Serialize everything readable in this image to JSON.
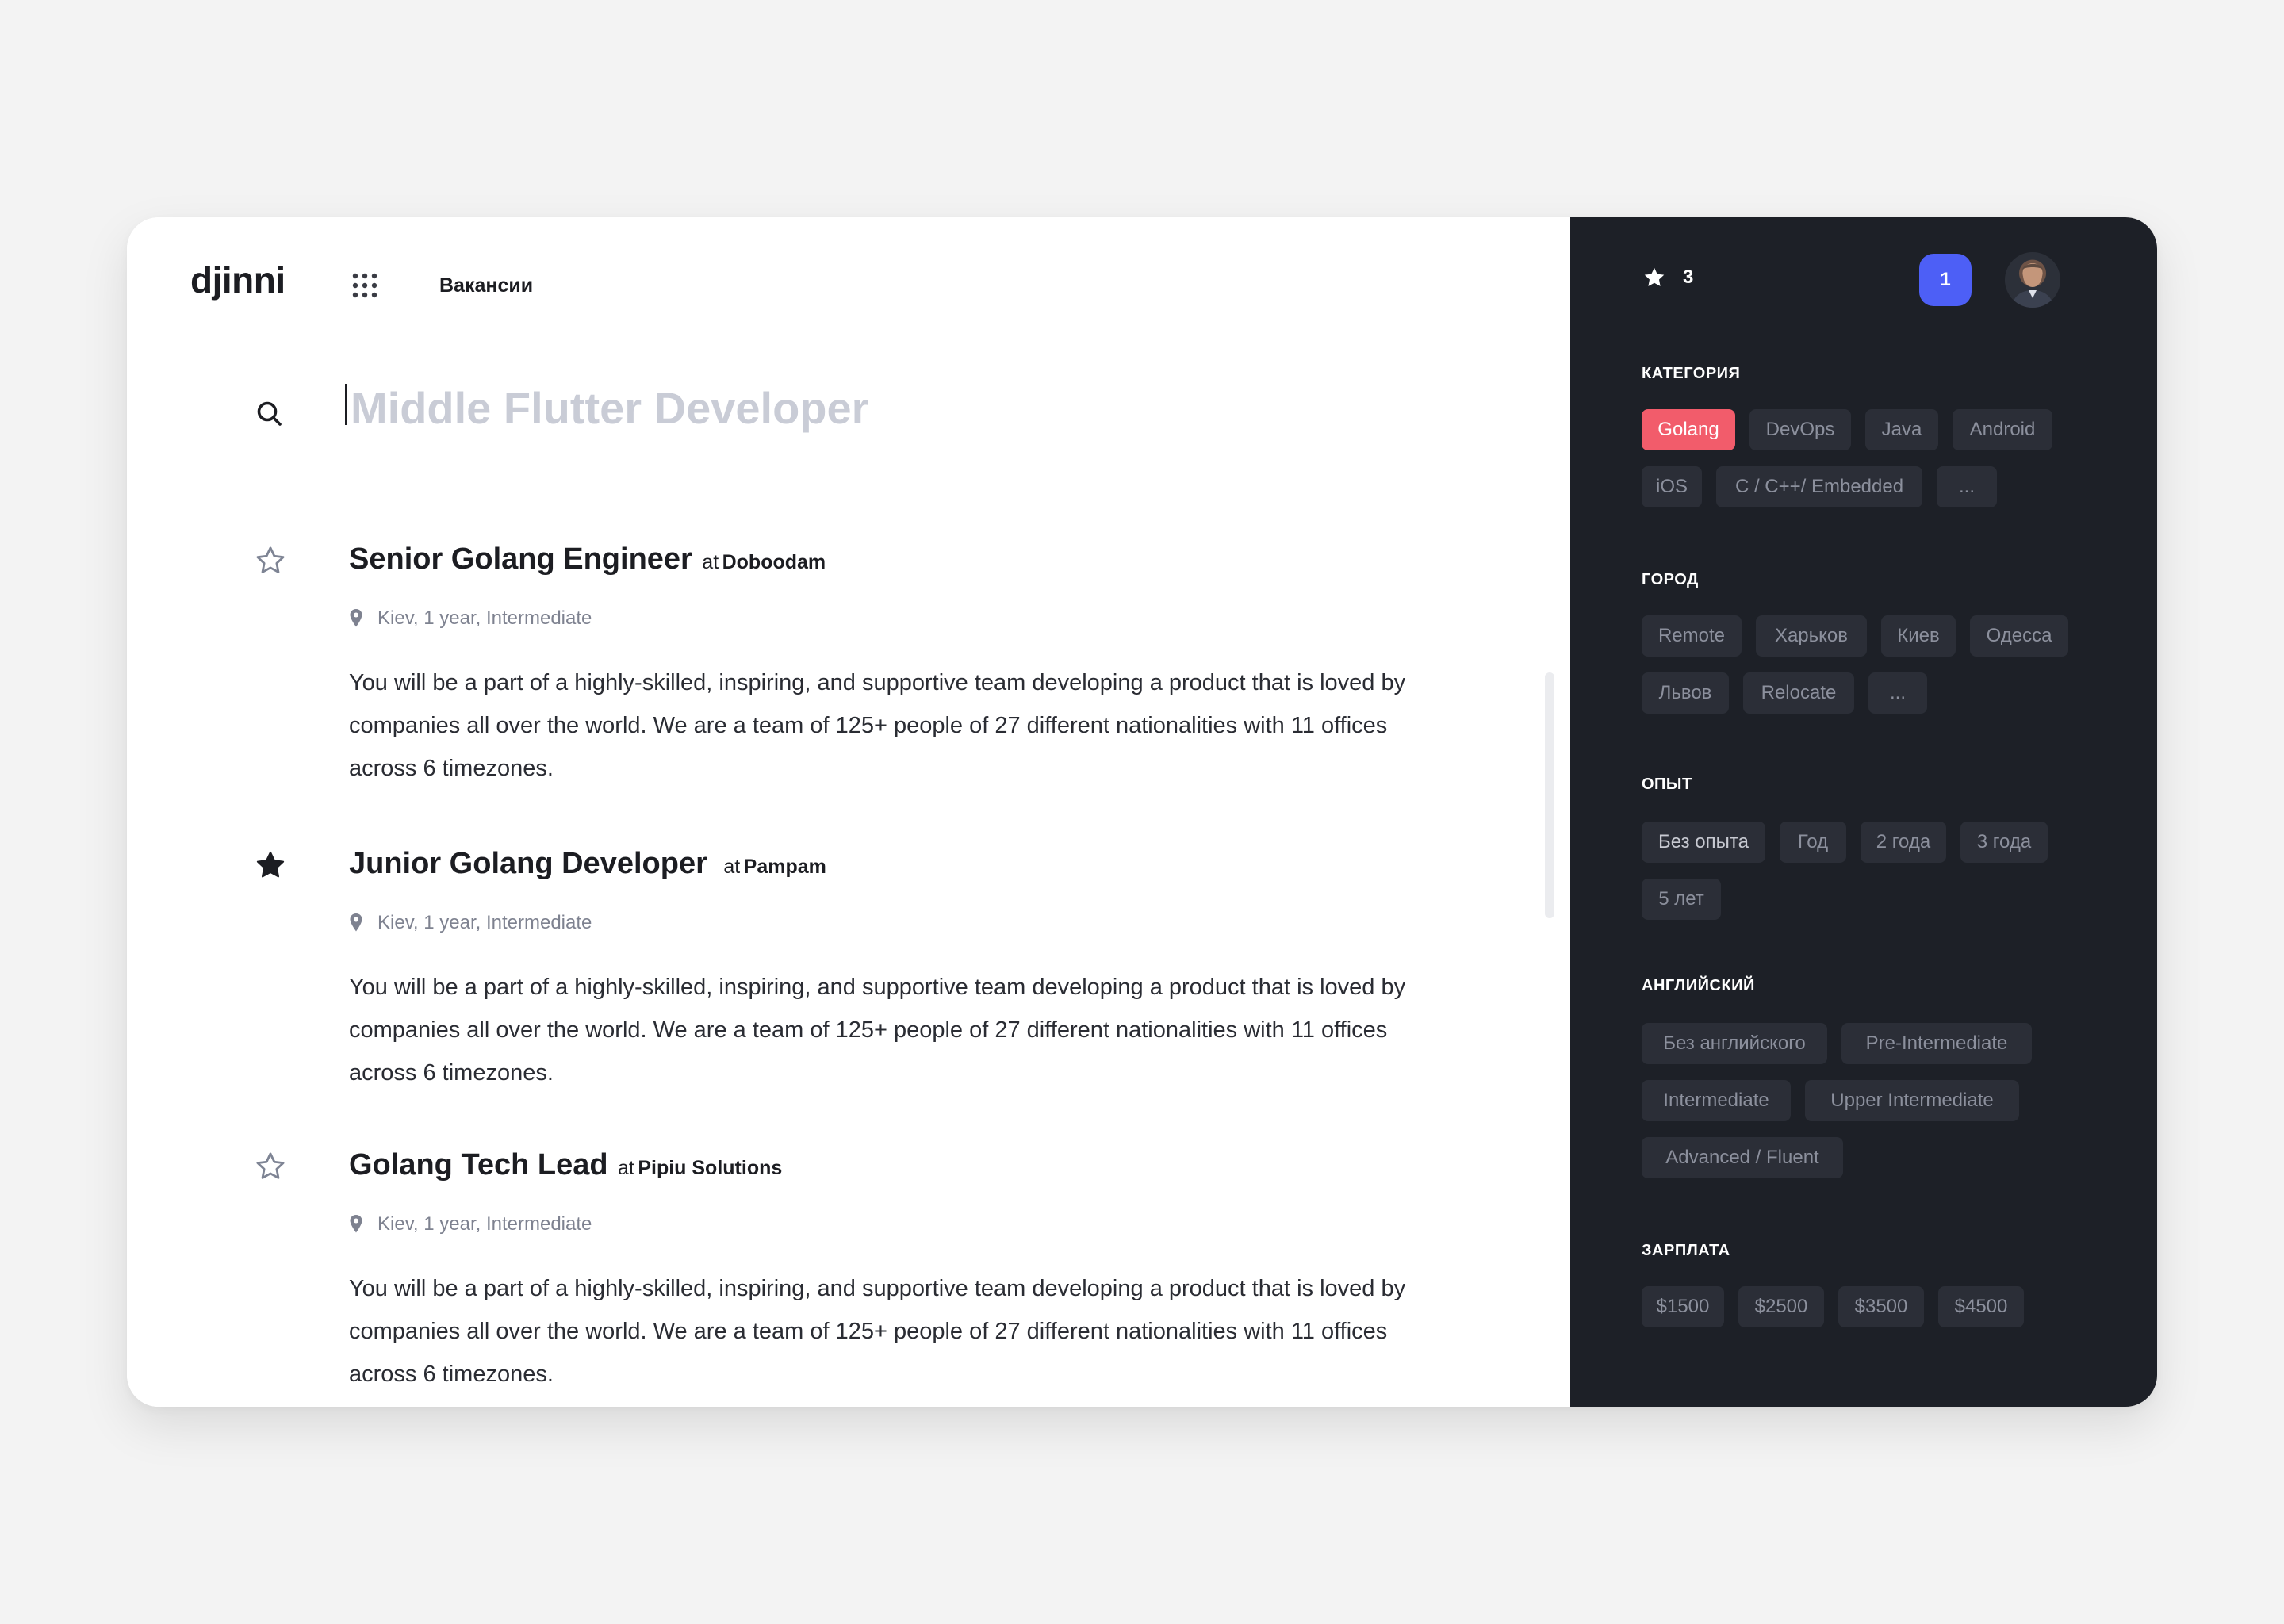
{
  "header": {
    "logo": "djinni",
    "nav_link": "Вакансии"
  },
  "search": {
    "placeholder": "Middle Flutter Developer",
    "value": ""
  },
  "jobs": [
    {
      "title": "Senior Golang Engineer",
      "at": "at",
      "company": "Doboodam",
      "meta": "Kiev, 1 year, Intermediate",
      "description": "You will be a part of a highly-skilled, inspiring, and supportive team developing a product that is loved by companies all over the world. We are a team of 125+ people of 27 different nationalities with 11 offices across 6 timezones.",
      "starred": false
    },
    {
      "title": "Junior Golang Developer",
      "at": "at",
      "company": "Pampam",
      "meta": "Kiev, 1 year, Intermediate",
      "description": "You will be a part of a highly-skilled, inspiring, and supportive team developing a product that is loved by companies all over the world. We are a team of 125+ people of 27 different nationalities with 11 offices across 6 timezones.",
      "starred": true
    },
    {
      "title": "Golang Tech Lead",
      "at": "at",
      "company": "Pipiu Solutions",
      "meta": "Kiev, 1 year, Intermediate",
      "description": "You will be a part of a highly-skilled, inspiring, and supportive team developing a product that is loved by companies all over the world. We are a team of 125+ people of 27 different nationalities with 11 offices across 6 timezones.",
      "starred": false
    }
  ],
  "sidebar": {
    "favorites_count": "3",
    "notifications_count": "1",
    "sections": [
      {
        "title": "КАТЕГОРИЯ",
        "chips": [
          "Golang",
          "DevOps",
          "Java",
          "Android",
          "iOS",
          "C / C++/ Embedded",
          "..."
        ]
      },
      {
        "title": "ГОРОД",
        "chips": [
          "Remote",
          "Харьков",
          "Киев",
          "Одесса",
          "Львов",
          "Relocate",
          "..."
        ]
      },
      {
        "title": "ОПЫТ",
        "chips": [
          "Без опыта",
          "Год",
          "2 года",
          "3 года",
          "5 лет"
        ]
      },
      {
        "title": "АНГЛИЙСКИЙ",
        "chips": [
          "Без английского",
          "Pre-Intermediate",
          "Intermediate",
          "Upper Intermediate",
          "Advanced / Fluent"
        ]
      },
      {
        "title": "ЗАРПЛАТА",
        "chips": [
          "$1500",
          "$2500",
          "$3500",
          "$4500"
        ]
      }
    ]
  },
  "colors": {
    "accent_red": "#f25c6b",
    "accent_blue": "#4d5ff6",
    "sidebar_bg": "#1d2027",
    "chip_bg": "#2b2e37"
  }
}
